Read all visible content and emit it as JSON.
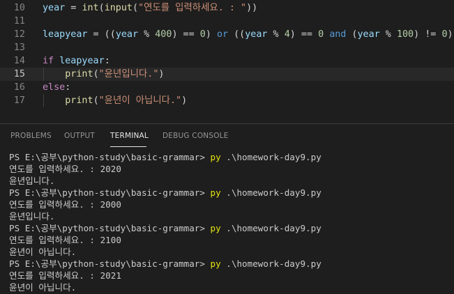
{
  "editor": {
    "lines": [
      {
        "no": "10",
        "active": false,
        "indent": false,
        "tokens": [
          {
            "t": "year",
            "c": "v"
          },
          {
            "t": " = ",
            "c": "p"
          },
          {
            "t": "int",
            "c": "f"
          },
          {
            "t": "(",
            "c": "p"
          },
          {
            "t": "input",
            "c": "f"
          },
          {
            "t": "(",
            "c": "p"
          },
          {
            "t": "\"연도를 입력하세요. : \"",
            "c": "s"
          },
          {
            "t": "))",
            "c": "p"
          }
        ]
      },
      {
        "no": "11",
        "active": false,
        "indent": false,
        "tokens": []
      },
      {
        "no": "12",
        "active": false,
        "indent": false,
        "tokens": [
          {
            "t": "leapyear",
            "c": "v"
          },
          {
            "t": " = ((",
            "c": "p"
          },
          {
            "t": "year",
            "c": "v"
          },
          {
            "t": " % ",
            "c": "p"
          },
          {
            "t": "400",
            "c": "n"
          },
          {
            "t": ") == ",
            "c": "p"
          },
          {
            "t": "0",
            "c": "n"
          },
          {
            "t": ") ",
            "c": "p"
          },
          {
            "t": "or",
            "c": "k"
          },
          {
            "t": " ((",
            "c": "p"
          },
          {
            "t": "year",
            "c": "v"
          },
          {
            "t": " % ",
            "c": "p"
          },
          {
            "t": "4",
            "c": "n"
          },
          {
            "t": ") == ",
            "c": "p"
          },
          {
            "t": "0",
            "c": "n"
          },
          {
            "t": " ",
            "c": "p"
          },
          {
            "t": "and",
            "c": "k"
          },
          {
            "t": " (",
            "c": "p"
          },
          {
            "t": "year",
            "c": "v"
          },
          {
            "t": " % ",
            "c": "p"
          },
          {
            "t": "100",
            "c": "n"
          },
          {
            "t": ") != ",
            "c": "p"
          },
          {
            "t": "0",
            "c": "n"
          },
          {
            "t": ")",
            "c": "p"
          }
        ]
      },
      {
        "no": "13",
        "active": false,
        "indent": false,
        "tokens": []
      },
      {
        "no": "14",
        "active": false,
        "indent": false,
        "tokens": [
          {
            "t": "if",
            "c": "c"
          },
          {
            "t": " ",
            "c": "p"
          },
          {
            "t": "leapyear",
            "c": "v"
          },
          {
            "t": ":",
            "c": "p"
          }
        ]
      },
      {
        "no": "15",
        "active": true,
        "indent": true,
        "tokens": [
          {
            "t": "    ",
            "c": "p"
          },
          {
            "t": "print",
            "c": "f"
          },
          {
            "t": "(",
            "c": "p"
          },
          {
            "t": "\"윤년입니다.\"",
            "c": "s"
          },
          {
            "t": ")",
            "c": "p"
          }
        ]
      },
      {
        "no": "16",
        "active": false,
        "indent": false,
        "tokens": [
          {
            "t": "else",
            "c": "c"
          },
          {
            "t": ":",
            "c": "p"
          }
        ]
      },
      {
        "no": "17",
        "active": false,
        "indent": true,
        "tokens": [
          {
            "t": "    ",
            "c": "p"
          },
          {
            "t": "print",
            "c": "f"
          },
          {
            "t": "(",
            "c": "p"
          },
          {
            "t": "\"윤년이 아닙니다.\"",
            "c": "s"
          },
          {
            "t": ")",
            "c": "p"
          }
        ]
      }
    ]
  },
  "panel": {
    "tabs": [
      {
        "label": "PROBLEMS",
        "active": false
      },
      {
        "label": "OUTPUT",
        "active": false
      },
      {
        "label": "TERMINAL",
        "active": true
      },
      {
        "label": "DEBUG CONSOLE",
        "active": false
      }
    ],
    "terminal_lines": [
      {
        "prompt": "PS E:\\공부\\python-study\\basic-grammar> ",
        "cmd": "py",
        "args": " .\\homework-day9.py"
      },
      {
        "text": "연도를 입력하세요. : 2020"
      },
      {
        "text": "윤년입니다."
      },
      {
        "prompt": "PS E:\\공부\\python-study\\basic-grammar> ",
        "cmd": "py",
        "args": " .\\homework-day9.py"
      },
      {
        "text": "연도를 입력하세요. : 2000"
      },
      {
        "text": "윤년입니다."
      },
      {
        "prompt": "PS E:\\공부\\python-study\\basic-grammar> ",
        "cmd": "py",
        "args": " .\\homework-day9.py"
      },
      {
        "text": "연도를 입력하세요. : 2100"
      },
      {
        "text": "윤년이 아닙니다."
      },
      {
        "prompt": "PS E:\\공부\\python-study\\basic-grammar> ",
        "cmd": "py",
        "args": " .\\homework-day9.py"
      },
      {
        "text": "연도를 입력하세요. : 2021"
      },
      {
        "text": "윤년이 아닙니다."
      }
    ]
  }
}
